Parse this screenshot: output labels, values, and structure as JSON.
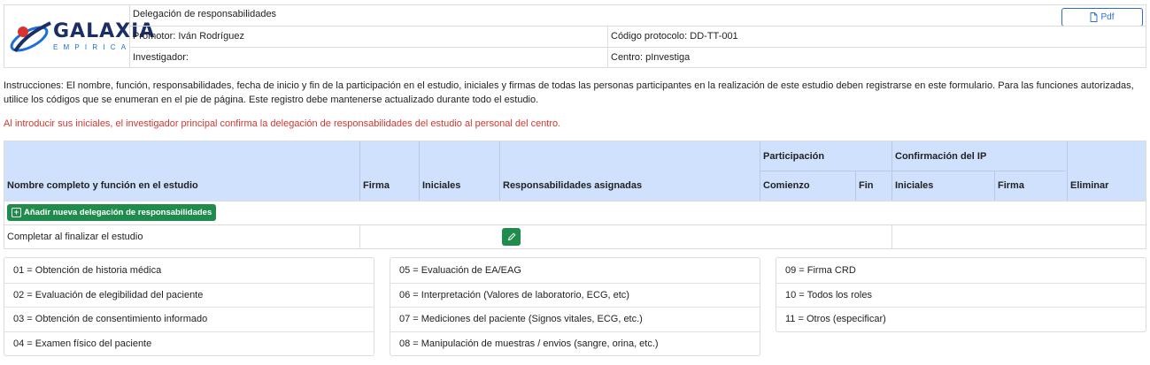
{
  "header": {
    "logo_word": "GALAXIA",
    "logo_sub": "EMPIRICA",
    "title": "Delegación de responsabilidades",
    "pdf_label": "Pdf",
    "promotor": "Promotor: Iván Rodríguez",
    "protocolo": "Código protocolo: DD-TT-001",
    "investigador": "Investigador:",
    "centro": "Centro: pInvestiga"
  },
  "instructions": "Instrucciones: El nombre, función, responsabilidades, fecha de inicio y fin de la participación en el estudio, iniciales y firmas de todas las personas participantes en la realización de este estudio deben registrarse en este formulario. Para las funciones autorizadas, utilice los códigos que se enumeran en el pie de página. Este registro debe mantenerse actualizado durante todo el estudio.",
  "warning": "Al introducir sus iniciales, el investigador principal confirma la delegación de responsabilidades del estudio al personal del centro.",
  "table": {
    "headers": {
      "nombre": "Nombre completo y función en el estudio",
      "firma": "Firma",
      "iniciales": "Iniciales",
      "responsabilidades": "Responsabilidades asignadas",
      "participacion": "Participación",
      "comienzo": "Comienzo",
      "fin": "Fin",
      "confirmacion": "Confirmación del IP",
      "ip_iniciales": "Iniciales",
      "ip_firma": "Firma",
      "eliminar": "Eliminar"
    },
    "add_button": "Añadir nueva delegación de responsabilidades",
    "final_row": "Completar al finalizar el estudio"
  },
  "legend": {
    "col1": [
      "01 = Obtención de historia médica",
      "02 = Evaluación de elegibilidad del paciente",
      "03 = Obtención de consentimiento informado",
      "04 = Examen físico del paciente"
    ],
    "col2": [
      "05 = Evaluación de EA/EAG",
      "06 = Interpretación (Valores de laboratorio, ECG, etc)",
      "07 = Mediciones del paciente (Signos vitales, ECG, etc.)",
      "08 = Manipulación de muestras / envios (sangre, orina, etc.)"
    ],
    "col3": [
      "09 = Firma CRD",
      "10 = Todos los roles",
      "11 = Otros (especificar)"
    ]
  },
  "colors": {
    "accent_green": "#1f8b4c",
    "header_blue": "#cfe1fd",
    "warning_red": "#d8342f",
    "pdf_blue": "#2b6cd1"
  },
  "icons": [
    "galaxia-logo-icon",
    "pdf-file-icon",
    "plus-square-icon",
    "pencil-icon"
  ]
}
